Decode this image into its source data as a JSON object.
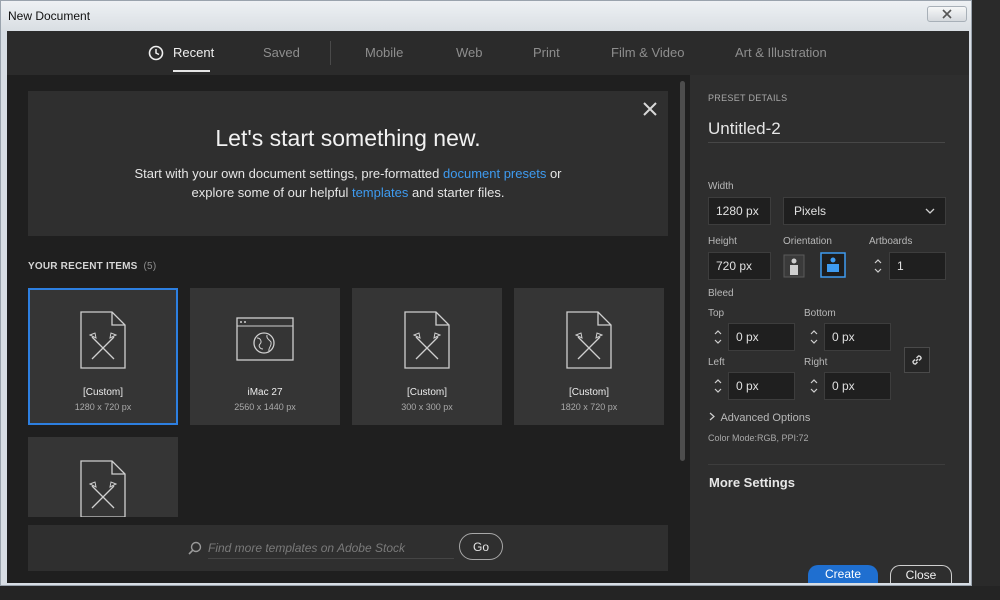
{
  "window": {
    "title": "New Document"
  },
  "tabs": [
    {
      "label": "Recent",
      "active": true,
      "icon": "clock-icon"
    },
    {
      "label": "Saved"
    },
    {
      "label": "Mobile"
    },
    {
      "label": "Web"
    },
    {
      "label": "Print"
    },
    {
      "label": "Film & Video"
    },
    {
      "label": "Art & Illustration"
    }
  ],
  "welcome": {
    "title": "Let's start something new.",
    "text_1": "Start with your own document settings, pre-formatted ",
    "link_presets": "document presets",
    "text_2": " or",
    "text_3": "explore some of our helpful ",
    "link_templates": "templates",
    "text_4": " and starter files."
  },
  "recent": {
    "label": "YOUR RECENT ITEMS",
    "count": "(5)",
    "items": [
      {
        "name": "[Custom]",
        "size": "1280 x 720 px",
        "icon": "custom-document-icon",
        "selected": true
      },
      {
        "name": "iMac 27",
        "size": "2560 x 1440 px",
        "icon": "web-browser-icon"
      },
      {
        "name": "[Custom]",
        "size": "300 x 300 px",
        "icon": "custom-document-icon"
      },
      {
        "name": "[Custom]",
        "size": "1820 x 720 px",
        "icon": "custom-document-icon"
      },
      {
        "name": "",
        "size": "",
        "icon": "custom-document-icon"
      }
    ]
  },
  "search": {
    "placeholder": "Find more templates on Adobe Stock",
    "go_label": "Go"
  },
  "preset": {
    "header": "PRESET DETAILS",
    "name": "Untitled-2",
    "width_label": "Width",
    "width_value": "1280 px",
    "unit": "Pixels",
    "height_label": "Height",
    "height_value": "720 px",
    "orientation_label": "Orientation",
    "artboards_label": "Artboards",
    "artboards_value": "1",
    "bleed_label": "Bleed",
    "top_label": "Top",
    "top_value": "0 px",
    "bottom_label": "Bottom",
    "bottom_value": "0 px",
    "left_label": "Left",
    "left_value": "0 px",
    "right_label": "Right",
    "right_value": "0 px",
    "advanced": "Advanced Options",
    "color_mode": "Color Mode:RGB, PPI:72",
    "more_settings": "More Settings",
    "create": "Create",
    "close": "Close"
  },
  "colors": {
    "accent": "#2d7fe0",
    "link": "#3e9bf0",
    "panel": "#2e2e2e",
    "left_bg": "#1f1f1f"
  }
}
